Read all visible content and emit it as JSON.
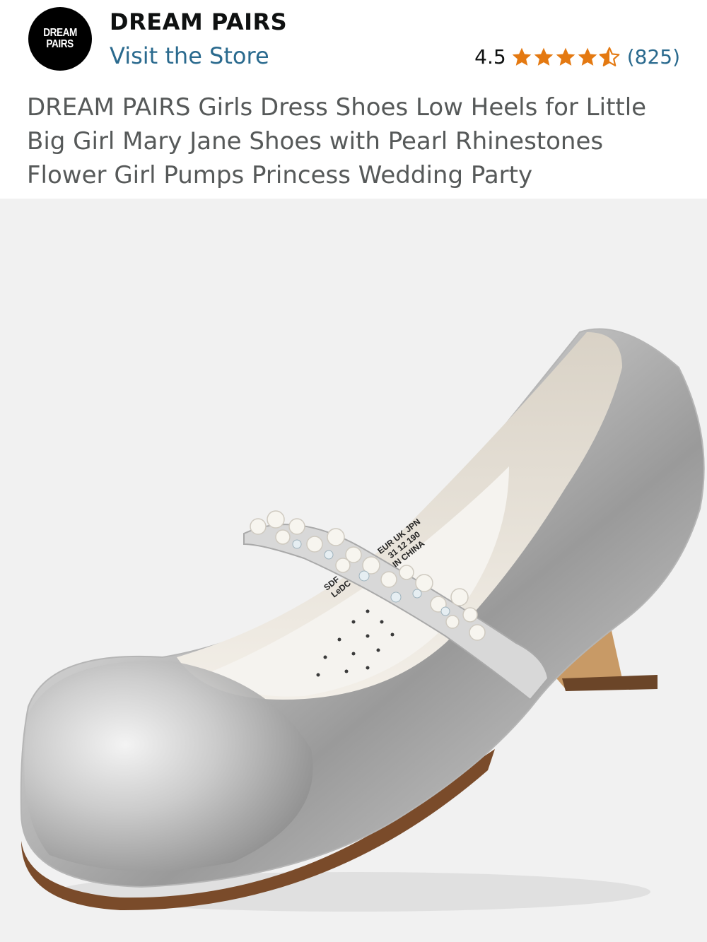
{
  "brand": {
    "logo_line1": "DREAM",
    "logo_line2": "PAIRS",
    "name": "DREAM PAIRS",
    "store_link": "Visit the Store"
  },
  "rating": {
    "value": "4.5",
    "stars": 4.5,
    "count": "(825)",
    "star_color": "#e47911"
  },
  "product": {
    "title": "DREAM PAIRS Girls Dress Shoes Low Heels for Little Big Girl Mary Jane Shoes with Pearl Rhinestones Flower Girl Pumps Princess Wedding Party",
    "image_label": {
      "line1": "EUR UK JPN",
      "line2": "31  12  190",
      "line3": "IN CHINA",
      "line4": "SDF",
      "line5": "LeDC"
    }
  },
  "colors": {
    "link": "#2a6a8e",
    "image_background": "#f1f1f1"
  }
}
